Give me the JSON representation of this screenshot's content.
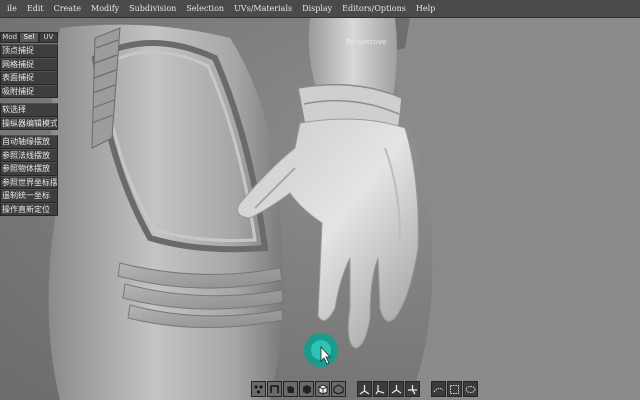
{
  "menubar": {
    "items": [
      "ile",
      "Edit",
      "Create",
      "Modify",
      "Subdivision",
      "Selection",
      "UVs/Materials",
      "Display",
      "Editors/Options",
      "Help"
    ]
  },
  "viewport": {
    "label": "Perspective"
  },
  "side_panel": {
    "tabs": [
      {
        "label": "Mod",
        "active": false
      },
      {
        "label": "Sel",
        "active": true
      },
      {
        "label": "UV",
        "active": false
      }
    ],
    "group1": [
      "顶点捕捉",
      "网格捕捉",
      "表面捕捉",
      "吸附捕捉"
    ],
    "group2": [
      "软选择",
      "操纵器编辑模式"
    ],
    "group3": [
      "自动轴缘摆放",
      "参照法线摆放",
      "参照物体摆放",
      "参照世界坐标摆放",
      "遥制统一坐标",
      "操作直新定位"
    ]
  },
  "toolbar": {
    "buttons": [
      "vertex-mode-icon",
      "edge-mode-icon",
      "face-mode-icon",
      "object-mode-icon",
      "cube-mode-icon",
      "wireframe-mode-icon",
      "axis-move-icon",
      "axis-rotate-icon",
      "axis-scale-icon",
      "axis-universal-icon",
      "grid-snap-icon",
      "surface-snap-icon",
      "dotted-snap-icon"
    ]
  },
  "colors": {
    "viewport_bg": "#7d7d7d",
    "menubar_bg": "#4a4a4a",
    "panel_button_bg": "#3e3e3e",
    "cursor_accent": "#0f9e8e"
  }
}
